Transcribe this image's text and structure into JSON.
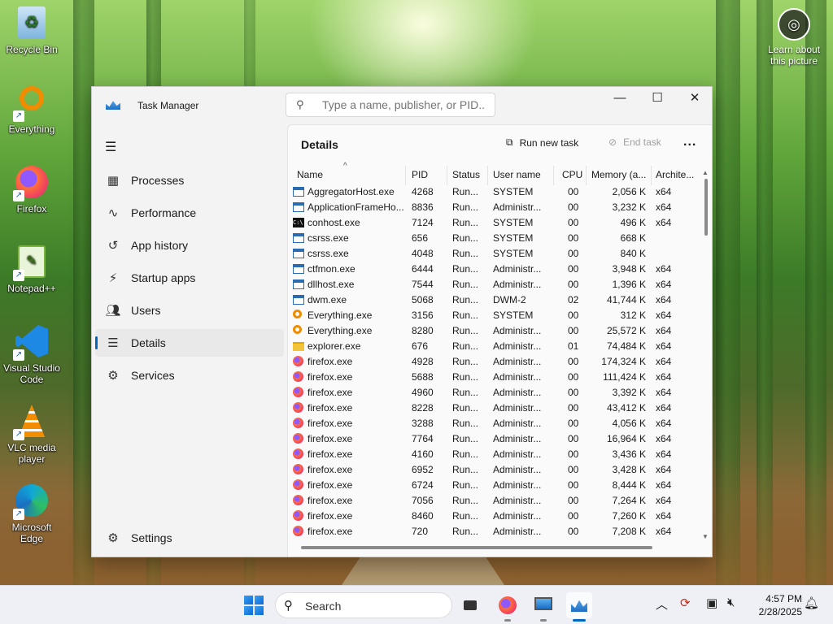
{
  "desktop": {
    "icons": [
      {
        "label": "Recycle Bin",
        "icon": "recycle-bin-icon"
      },
      {
        "label": "Everything",
        "icon": "everything-search-icon"
      },
      {
        "label": "Firefox",
        "icon": "firefox-icon"
      },
      {
        "label": "Notepad++",
        "icon": "notepad-plus-plus-icon"
      },
      {
        "label": "Visual Studio Code",
        "icon": "vscode-icon"
      },
      {
        "label": "VLC media player",
        "icon": "vlc-icon"
      },
      {
        "label": "Microsoft Edge",
        "icon": "edge-icon"
      }
    ],
    "learn_about": "Learn about this picture"
  },
  "window": {
    "title": "Task Manager",
    "search_placeholder": "Type a name, publisher, or PID...",
    "nav": [
      {
        "label": "Processes",
        "icon": "processes-icon"
      },
      {
        "label": "Performance",
        "icon": "performance-icon"
      },
      {
        "label": "App history",
        "icon": "app-history-icon"
      },
      {
        "label": "Startup apps",
        "icon": "startup-apps-icon"
      },
      {
        "label": "Users",
        "icon": "users-icon"
      },
      {
        "label": "Details",
        "icon": "details-icon",
        "selected": true
      },
      {
        "label": "Services",
        "icon": "services-icon"
      }
    ],
    "settings_label": "Settings",
    "panel": {
      "title": "Details",
      "run_new_task": "Run new task",
      "end_task": "End task",
      "more": "..."
    },
    "columns": [
      "Name",
      "PID",
      "Status",
      "User name",
      "CPU",
      "Memory (a...",
      "Archite..."
    ],
    "rows": [
      {
        "name": "AggregatorHost.exe",
        "pid": "4268",
        "status": "Run...",
        "user": "SYSTEM",
        "cpu": "00",
        "mem": "2,056 K",
        "arch": "x64",
        "icon": "window"
      },
      {
        "name": "ApplicationFrameHo...",
        "pid": "8836",
        "status": "Run...",
        "user": "Administr...",
        "cpu": "00",
        "mem": "3,232 K",
        "arch": "x64",
        "icon": "window"
      },
      {
        "name": "conhost.exe",
        "pid": "7124",
        "status": "Run...",
        "user": "SYSTEM",
        "cpu": "00",
        "mem": "496 K",
        "arch": "x64",
        "icon": "console"
      },
      {
        "name": "csrss.exe",
        "pid": "656",
        "status": "Run...",
        "user": "SYSTEM",
        "cpu": "00",
        "mem": "668 K",
        "arch": "",
        "icon": "window"
      },
      {
        "name": "csrss.exe",
        "pid": "4048",
        "status": "Run...",
        "user": "SYSTEM",
        "cpu": "00",
        "mem": "840 K",
        "arch": "",
        "icon": "window"
      },
      {
        "name": "ctfmon.exe",
        "pid": "6444",
        "status": "Run...",
        "user": "Administr...",
        "cpu": "00",
        "mem": "3,948 K",
        "arch": "x64",
        "icon": "window"
      },
      {
        "name": "dllhost.exe",
        "pid": "7544",
        "status": "Run...",
        "user": "Administr...",
        "cpu": "00",
        "mem": "1,396 K",
        "arch": "x64",
        "icon": "window"
      },
      {
        "name": "dwm.exe",
        "pid": "5068",
        "status": "Run...",
        "user": "DWM-2",
        "cpu": "02",
        "mem": "41,744 K",
        "arch": "x64",
        "icon": "window"
      },
      {
        "name": "Everything.exe",
        "pid": "3156",
        "status": "Run...",
        "user": "SYSTEM",
        "cpu": "00",
        "mem": "312 K",
        "arch": "x64",
        "icon": "everything"
      },
      {
        "name": "Everything.exe",
        "pid": "8280",
        "status": "Run...",
        "user": "Administr...",
        "cpu": "00",
        "mem": "25,572 K",
        "arch": "x64",
        "icon": "everything"
      },
      {
        "name": "explorer.exe",
        "pid": "676",
        "status": "Run...",
        "user": "Administr...",
        "cpu": "01",
        "mem": "74,484 K",
        "arch": "x64",
        "icon": "folder"
      },
      {
        "name": "firefox.exe",
        "pid": "4928",
        "status": "Run...",
        "user": "Administr...",
        "cpu": "00",
        "mem": "174,324 K",
        "arch": "x64",
        "icon": "firefox"
      },
      {
        "name": "firefox.exe",
        "pid": "5688",
        "status": "Run...",
        "user": "Administr...",
        "cpu": "00",
        "mem": "111,424 K",
        "arch": "x64",
        "icon": "firefox"
      },
      {
        "name": "firefox.exe",
        "pid": "4960",
        "status": "Run...",
        "user": "Administr...",
        "cpu": "00",
        "mem": "3,392 K",
        "arch": "x64",
        "icon": "firefox"
      },
      {
        "name": "firefox.exe",
        "pid": "8228",
        "status": "Run...",
        "user": "Administr...",
        "cpu": "00",
        "mem": "43,412 K",
        "arch": "x64",
        "icon": "firefox"
      },
      {
        "name": "firefox.exe",
        "pid": "3288",
        "status": "Run...",
        "user": "Administr...",
        "cpu": "00",
        "mem": "4,056 K",
        "arch": "x64",
        "icon": "firefox"
      },
      {
        "name": "firefox.exe",
        "pid": "7764",
        "status": "Run...",
        "user": "Administr...",
        "cpu": "00",
        "mem": "16,964 K",
        "arch": "x64",
        "icon": "firefox"
      },
      {
        "name": "firefox.exe",
        "pid": "4160",
        "status": "Run...",
        "user": "Administr...",
        "cpu": "00",
        "mem": "3,436 K",
        "arch": "x64",
        "icon": "firefox"
      },
      {
        "name": "firefox.exe",
        "pid": "6952",
        "status": "Run...",
        "user": "Administr...",
        "cpu": "00",
        "mem": "3,428 K",
        "arch": "x64",
        "icon": "firefox"
      },
      {
        "name": "firefox.exe",
        "pid": "6724",
        "status": "Run...",
        "user": "Administr...",
        "cpu": "00",
        "mem": "8,444 K",
        "arch": "x64",
        "icon": "firefox"
      },
      {
        "name": "firefox.exe",
        "pid": "7056",
        "status": "Run...",
        "user": "Administr...",
        "cpu": "00",
        "mem": "7,264 K",
        "arch": "x64",
        "icon": "firefox"
      },
      {
        "name": "firefox.exe",
        "pid": "8460",
        "status": "Run...",
        "user": "Administr...",
        "cpu": "00",
        "mem": "7,260 K",
        "arch": "x64",
        "icon": "firefox"
      },
      {
        "name": "firefox.exe",
        "pid": "720",
        "status": "Run...",
        "user": "Administr...",
        "cpu": "00",
        "mem": "7,208 K",
        "arch": "x64",
        "icon": "firefox"
      }
    ]
  },
  "taskbar": {
    "search_label": "Search",
    "time": "4:57 PM",
    "date": "2/28/2025"
  },
  "colors": {
    "accent": "#0067c0",
    "firefox": "#ff7139",
    "everything": "#f08c00"
  }
}
